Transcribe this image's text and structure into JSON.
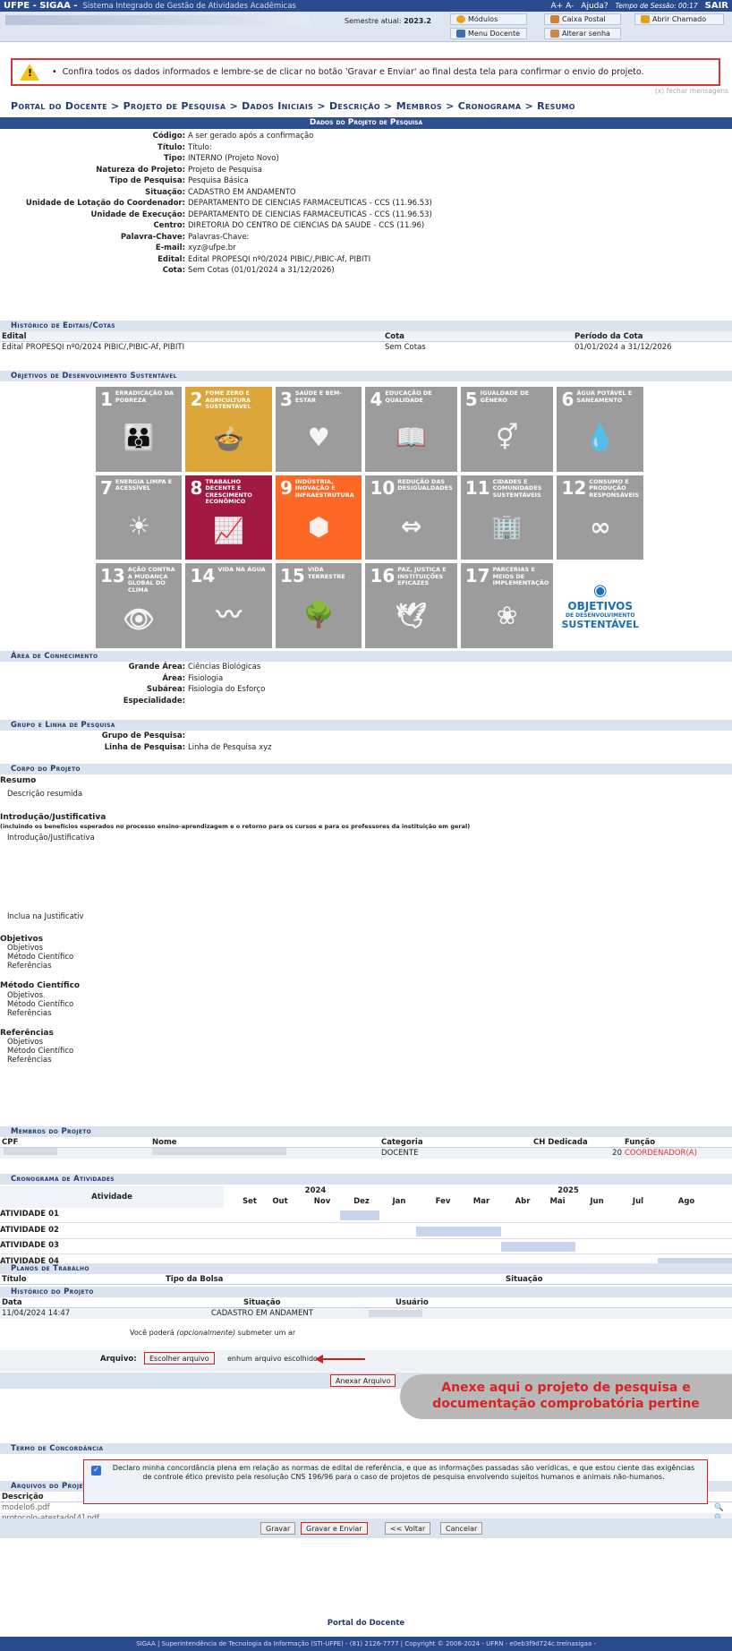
{
  "topbar": {
    "brand": "UFPE - SIGAA -",
    "system": "Sistema Integrado de Gestão de Atividades Acadêmicas",
    "font_controls": "A+ A-",
    "help": "Ajuda?",
    "session_label": "Tempo de Sessão: 00:17",
    "exit": "SAIR"
  },
  "userbar": {
    "semester_label": "Semestre atual:",
    "semester_value": "2023.2",
    "modules": "Módulos",
    "mailbox": "Caixa Postal",
    "open_ticket": "Abrir Chamado",
    "teacher_menu": "Menu Docente",
    "change_password": "Alterar senha"
  },
  "warning": {
    "text": "Confira todos os dados informados e lembre-se de clicar no botão 'Gravar e Enviar' ao final desta tela para confirmar o envio do projeto.",
    "close": "(x) fechar mensagens"
  },
  "breadcrumb": "Portal do Docente > Projeto de Pesquisa > Dados Iniciais > Descrição > Membros > Cronograma > Resumo",
  "project": {
    "title": "Dados do Projeto de Pesquisa",
    "fields": [
      {
        "k": "Código:",
        "v": "A ser gerado após a confirmação"
      },
      {
        "k": "Título:",
        "v": "Título:"
      },
      {
        "k": "Tipo:",
        "v": "INTERNO (Projeto Novo)"
      },
      {
        "k": "Natureza do Projeto:",
        "v": "Projeto de Pesquisa"
      },
      {
        "k": "Tipo de Pesquisa:",
        "v": "Pesquisa Básica"
      },
      {
        "k": "Situação:",
        "v": "CADASTRO EM ANDAMENTO"
      },
      {
        "k": "Unidade de Lotação do Coordenador:",
        "v": "DEPARTAMENTO DE CIENCIAS FARMACEUTICAS - CCS (11.96.53)"
      },
      {
        "k": "Unidade de Execução:",
        "v": "DEPARTAMENTO DE CIENCIAS FARMACEUTICAS - CCS (11.96.53)"
      },
      {
        "k": "Centro:",
        "v": "DIRETORIA DO CENTRO DE CIENCIAS DA SAUDE - CCS (11.96)"
      },
      {
        "k": "Palavra-Chave:",
        "v": "Palavras-Chave:"
      },
      {
        "k": "E-mail:",
        "v": "xyz@ufpe.br"
      },
      {
        "k": "Edital:",
        "v": "Edital PROPESQI nº0/2024 PIBIC/,PIBIC-Af, PIBITI"
      },
      {
        "k": "Cota:",
        "v": "Sem Cotas (01/01/2024 a 31/12/2026)"
      }
    ]
  },
  "history_edital": {
    "title": "Histórico de Editais/Cotas",
    "cols": [
      "Edital",
      "Cota",
      "Período da Cota"
    ],
    "row": [
      "Edital PROPESQI nº0/2024 PIBIC/,PIBIC-Af, PIBITI",
      "Sem Cotas",
      "01/01/2024 a 31/12/2026"
    ]
  },
  "ods": {
    "title": "Objetivos de Desenvolvimento Sustentável",
    "tiles": [
      {
        "n": "1",
        "t": "Erradicação da pobreza",
        "g": "👪",
        "c": "grey"
      },
      {
        "n": "2",
        "t": "Fome zero e agricultura sustentável",
        "g": "🍲",
        "c": "#dda63a"
      },
      {
        "n": "3",
        "t": "Saúde e bem-estar",
        "g": "♥",
        "c": "grey"
      },
      {
        "n": "4",
        "t": "Educação de qualidade",
        "g": "📖",
        "c": "grey"
      },
      {
        "n": "5",
        "t": "Igualdade de gênero",
        "g": "⚥",
        "c": "grey"
      },
      {
        "n": "6",
        "t": "Água potável e saneamento",
        "g": "💧",
        "c": "grey"
      },
      {
        "n": "7",
        "t": "Energia limpa e acessível",
        "g": "☀",
        "c": "grey"
      },
      {
        "n": "8",
        "t": "Trabalho decente e crescimento econômico",
        "g": "📈",
        "c": "#a21942"
      },
      {
        "n": "9",
        "t": "Indústria, inovação e infraestrutura",
        "g": "⬢",
        "c": "#fd6925"
      },
      {
        "n": "10",
        "t": "Redução das desigualdades",
        "g": "⇔",
        "c": "grey"
      },
      {
        "n": "11",
        "t": "Cidades e comunidades sustentáveis",
        "g": "🏢",
        "c": "grey"
      },
      {
        "n": "12",
        "t": "Consumo e produção responsáveis",
        "g": "∞",
        "c": "grey"
      },
      {
        "n": "13",
        "t": "Ação contra a mudança global do clima",
        "g": "👁",
        "c": "grey"
      },
      {
        "n": "14",
        "t": "Vida na água",
        "g": "〰",
        "c": "grey"
      },
      {
        "n": "15",
        "t": "Vida terrestre",
        "g": "🌳",
        "c": "grey"
      },
      {
        "n": "16",
        "t": "Paz, justiça e instituições eficazes",
        "g": "🕊",
        "c": "grey"
      },
      {
        "n": "17",
        "t": "Parcerias e meios de implementação",
        "g": "❀",
        "c": "grey"
      }
    ],
    "logo_a": "OBJETIVOS",
    "logo_b": "DE DESENVOLVIMENTO",
    "logo_c": "SUSTENTÁVEL"
  },
  "area": {
    "title": "Área de Conhecimento",
    "fields": [
      {
        "k": "Grande Área:",
        "v": "Ciências Biológicas"
      },
      {
        "k": "Área:",
        "v": "Fisiologia"
      },
      {
        "k": "Subárea:",
        "v": "Fisiologia do Esforço"
      },
      {
        "k": "Especialidade:",
        "v": ""
      }
    ]
  },
  "group": {
    "title": "Grupo e Linha de Pesquisa",
    "fields": [
      {
        "k": "Grupo de Pesquisa:",
        "v": ""
      },
      {
        "k": "Linha de Pesquisa:",
        "v": "Linha de Pesquisa xyz"
      }
    ]
  },
  "body": {
    "title": "Corpo do Projeto",
    "resumo_h": "Resumo",
    "resumo": "Descrição resumida",
    "intro_h": "Introdução/Justificativa",
    "intro_note": "(incluindo os benefícios esperados no processo ensino-aprendizagem e o retorno para os cursos e para os professores da instituição em geral)",
    "intro": "Introdução/Justificativa",
    "intro2": "Inclua na Justificativ",
    "obj_h": "Objetivos",
    "met_h": "Método Científico",
    "ref_h": "Referências",
    "l1": "Objetivos",
    "l2": "Método Científico",
    "l3": "Referências"
  },
  "members": {
    "title": "Membros do Projeto",
    "cols": [
      "CPF",
      "Nome",
      "Categoria",
      "CH Dedicada",
      "Função"
    ],
    "row": {
      "cat": "DOCENTE",
      "ch": "20",
      "func": "COORDENADOR(A)"
    }
  },
  "schedule": {
    "title": "Cronograma de Atividades",
    "activity": "Atividade",
    "y1": "2024",
    "y2": "2025",
    "months": [
      "Set",
      "Out",
      "Nov",
      "Dez",
      "Jan",
      "Fev",
      "Mar",
      "Abr",
      "Mai",
      "Jun",
      "Jul",
      "Ago"
    ],
    "rows": [
      "ATIVIDADE 01",
      "ATIVIDADE 02",
      "ATIVIDADE 03",
      "ATIVIDADE 04"
    ],
    "bars": [
      [
        3,
        4
      ],
      [
        5,
        7
      ],
      [
        7,
        9
      ],
      [
        11,
        12
      ]
    ]
  },
  "plans": {
    "title": "Planos de Trabalho",
    "cols": [
      "Título",
      "Tipo da Bolsa",
      "Situação"
    ]
  },
  "hist_proj": {
    "title": "Histórico do Projeto",
    "cols": [
      "Data",
      "Situação",
      "Usuário"
    ],
    "row": [
      "11/04/2024 14:47",
      "CADASTRO EM ANDAMENT",
      ""
    ]
  },
  "upload": {
    "note_a": "Você poderá",
    "note_b": "(opcionalmente)",
    "note_c": "submeter um ar",
    "label": "Arquivo:",
    "choose": "Escolher arquivo",
    "none": "enhum arquivo escolhido",
    "attach": "Anexar Arquivo"
  },
  "callout": {
    "line1": "Anexe aqui o projeto de pesquisa e",
    "line2": "documentação comprobatória pertine"
  },
  "files": {
    "title": "Arquivos do Projeto",
    "col": "Descrição",
    "items": [
      "modelo6.pdf",
      "protocolo-atestado[4].pdf"
    ]
  },
  "term": {
    "title": "Termo de Concordância",
    "text": "Declaro minha concordância plena em relação as normas de edital de referência, e que as informações passadas são verídicas, e que estou ciente das exigências de controle ético previsto pela resolução CNS 196/96 para o caso de projetos de pesquisa envolvendo sujeitos humanos e animais não-humanos."
  },
  "actions": {
    "save": "Gravar",
    "save_send": "Gravar e Enviar",
    "back": "<< Voltar",
    "cancel": "Cancelar",
    "portal": "Portal do Docente"
  },
  "footer": "SIGAA | Superintendência de Tecnologia da Informação (STI-UFPE) - (81) 2126-7777 | Copyright © 2006-2024 - UFRN - e0eb3f9d724c.treinasigaa -"
}
